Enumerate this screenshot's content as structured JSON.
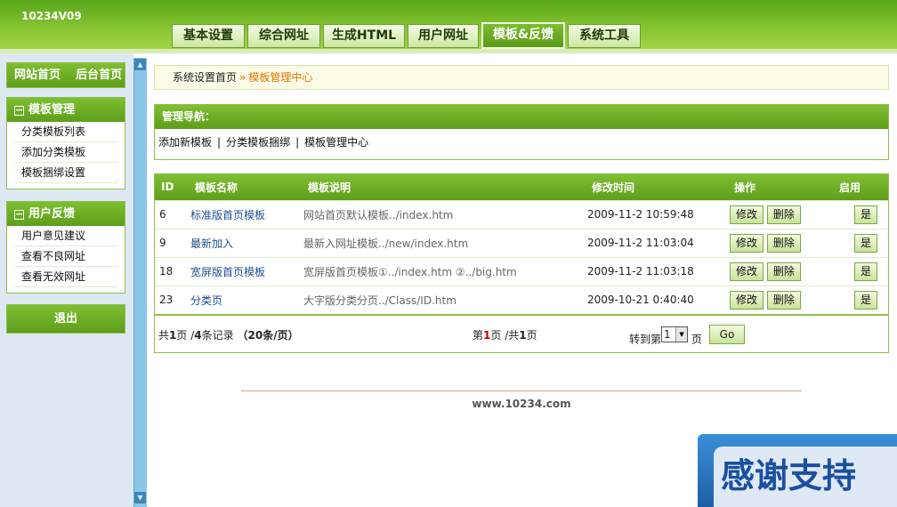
{
  "header": {
    "brand": "10234V09",
    "tabs": [
      {
        "label": "基本设置"
      },
      {
        "label": "综合网址"
      },
      {
        "label": "生成HTML"
      },
      {
        "label": "用户网址"
      },
      {
        "label": "模板&反馈",
        "active": true
      },
      {
        "label": "系统工具"
      }
    ]
  },
  "sidebar": {
    "top_links": {
      "site_home": "网站首页",
      "admin_home": "后台首页"
    },
    "sections": [
      {
        "title": "模板管理",
        "items": [
          "分类模板列表",
          "添加分类模板",
          "模板捆绑设置"
        ]
      },
      {
        "title": "用户反馈",
        "items": [
          "用户意见建议",
          "查看不良网址",
          "查看无效网址"
        ]
      }
    ],
    "logout": "退出"
  },
  "breadcrumb": {
    "home": "系统设置首页",
    "separator": "»",
    "current": "模板管理中心"
  },
  "manage_nav": {
    "title": "管理导航：",
    "links": [
      "添加新模板",
      "分类模板捆绑",
      "模板管理中心"
    ],
    "separator": "|"
  },
  "table": {
    "headers": [
      "ID",
      "模板名称",
      "模板说明",
      "修改时间",
      "操作",
      "启用"
    ],
    "rows": [
      {
        "id": "6",
        "name": "标准版首页模板",
        "desc": "网站首页默认模板../index.htm",
        "time": "2009-11-2 10:59:48",
        "edit": "修改",
        "delete": "删除",
        "enabled": "是"
      },
      {
        "id": "9",
        "name": "最新加入",
        "desc": "最新入网址模板../new/index.htm",
        "time": "2009-11-2 11:03:04",
        "edit": "修改",
        "delete": "删除",
        "enabled": "是"
      },
      {
        "id": "18",
        "name": "宽屏版首页模板",
        "desc": "宽屏版首页模板①../index.htm ②../big.htm",
        "time": "2009-11-2 11:03:18",
        "edit": "修改",
        "delete": "删除",
        "enabled": "是"
      },
      {
        "id": "23",
        "name": "分类页",
        "desc": "大字版分类分页../Class/ID.htm",
        "time": "2009-10-21 0:40:40",
        "edit": "修改",
        "delete": "删除",
        "enabled": "是"
      }
    ]
  },
  "pager": {
    "total_pages_prefix": "共",
    "total_pages": "1",
    "total_pages_suffix": "页",
    "records_prefix": "/",
    "records": "4",
    "records_suffix": "条记录",
    "per_page_prefix": "（",
    "per_page": "20",
    "per_page_suffix": "条/页）",
    "current_prefix": "第",
    "current": "1",
    "current_suffix": "页",
    "total2_prefix": "/共",
    "total2": "1",
    "total2_suffix": "页",
    "goto_prefix": "转到第",
    "goto_value": "1",
    "goto_suffix": "页",
    "go_label": "Go"
  },
  "footer": {
    "text": "www.10234.com"
  },
  "overlay": {
    "text": "感谢支持"
  },
  "colors": {
    "accent_green": "#6aae22",
    "link_blue": "#1d4f8c",
    "crumb_orange": "#e07800"
  }
}
